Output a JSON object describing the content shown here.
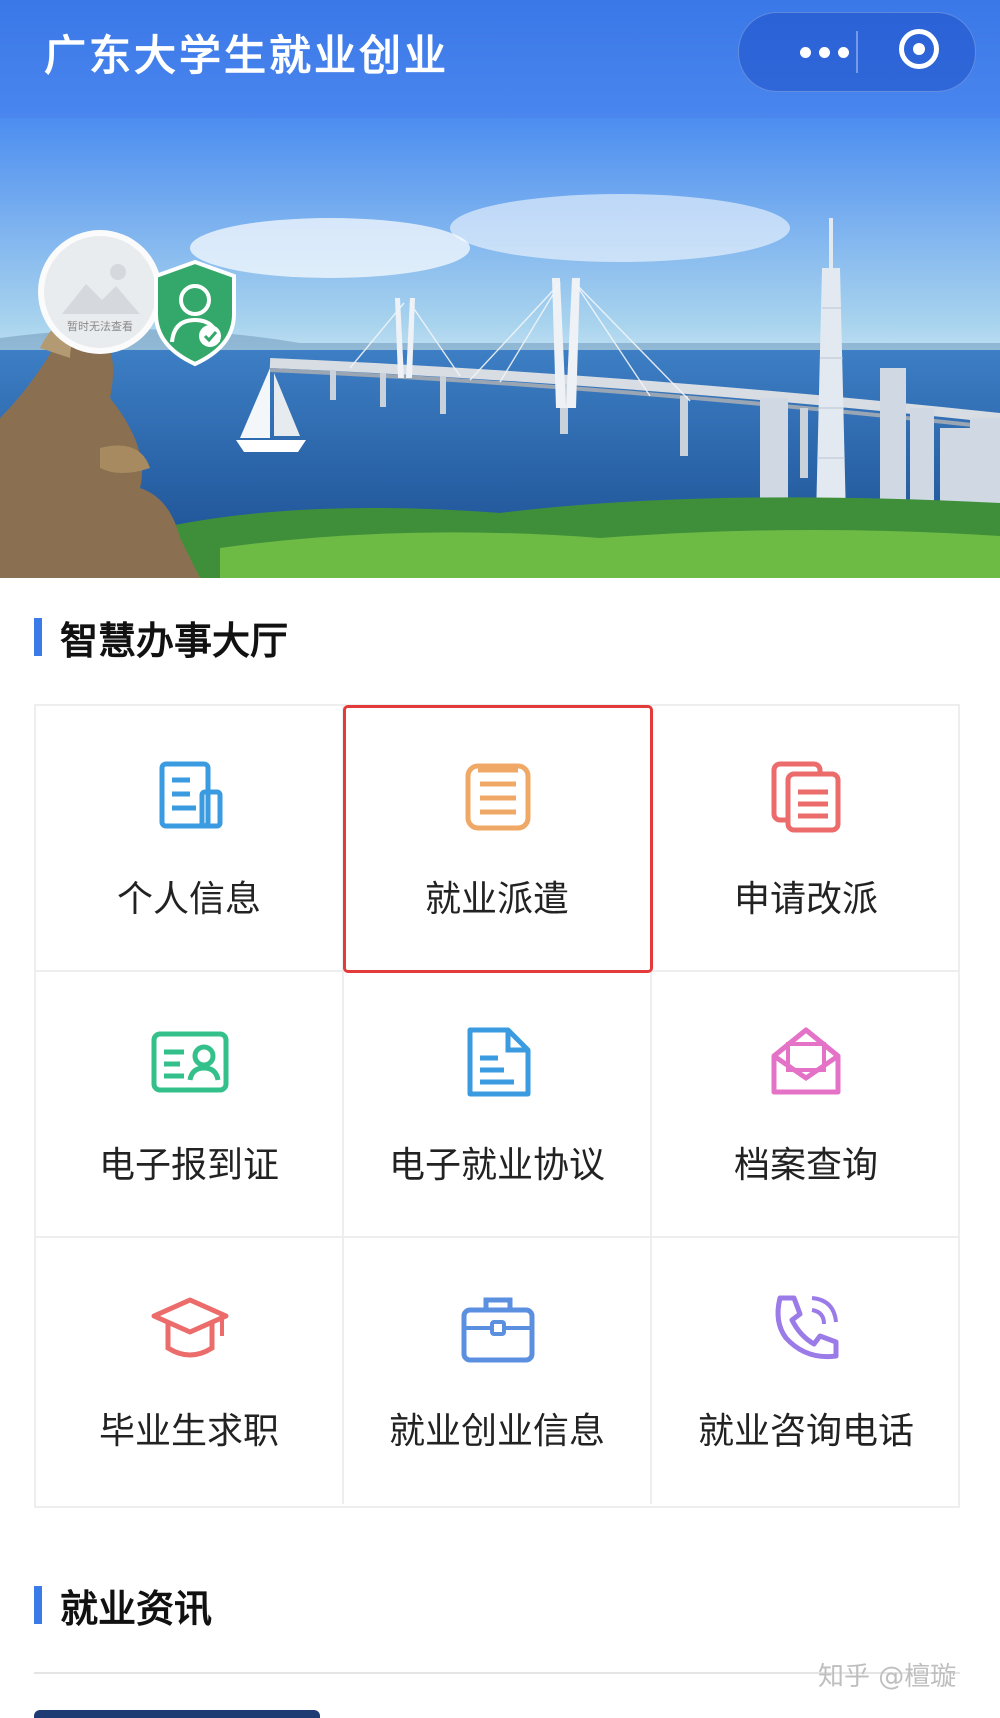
{
  "app": {
    "title": "广东大学生就业创业",
    "menu_icon": "more-dots-icon",
    "close_icon": "close-target-icon"
  },
  "banner": {
    "avatar_caption": "暂时无法查看",
    "verified_icon": "verified-shield-icon"
  },
  "sections": {
    "services_title": "智慧办事大厅",
    "news_title": "就业资讯"
  },
  "services": [
    {
      "label": "个人信息",
      "icon": "document-icon",
      "color": "#3a9be0"
    },
    {
      "label": "就业派遣",
      "icon": "list-document-icon",
      "color": "#f0a866",
      "highlighted": true
    },
    {
      "label": "申请改派",
      "icon": "copy-document-icon",
      "color": "#ec6b6b"
    },
    {
      "label": "电子报到证",
      "icon": "id-card-icon",
      "color": "#33c08a"
    },
    {
      "label": "电子就业协议",
      "icon": "file-text-icon",
      "color": "#3a9be0"
    },
    {
      "label": "档案查询",
      "icon": "envelope-icon",
      "color": "#e473c8"
    },
    {
      "label": "毕业生求职",
      "icon": "graduation-cap-icon",
      "color": "#ec6b6b"
    },
    {
      "label": "就业创业信息",
      "icon": "briefcase-icon",
      "color": "#5b8fe0"
    },
    {
      "label": "就业咨询电话",
      "icon": "phone-icon",
      "color": "#9b7be8"
    }
  ],
  "colors": {
    "accent": "#3a7be8",
    "highlight_border": "#e33a3a"
  },
  "watermark": "知乎 @檀璇"
}
